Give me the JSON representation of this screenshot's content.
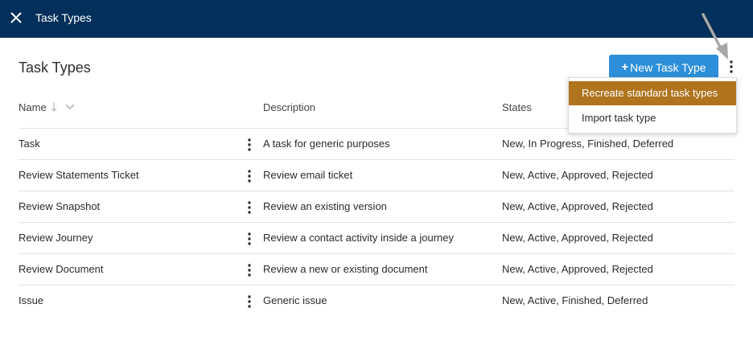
{
  "topbar": {
    "title": "Task Types"
  },
  "page": {
    "title": "Task Types"
  },
  "toolbar": {
    "new_label": "New Task Type",
    "new_plus": "+"
  },
  "columns": {
    "name": "Name",
    "description": "Description",
    "states": "States"
  },
  "rows": [
    {
      "name": "Task",
      "description": "A task for generic purposes",
      "states": "New, In Progress, Finished, Deferred"
    },
    {
      "name": "Review Statements Ticket",
      "description": "Review email ticket",
      "states": "New, Active, Approved, Rejected"
    },
    {
      "name": "Review Snapshot",
      "description": "Review an existing version",
      "states": "New, Active, Approved, Rejected"
    },
    {
      "name": "Review Journey",
      "description": "Review a contact activity inside a journey",
      "states": "New, Active, Approved, Rejected"
    },
    {
      "name": "Review Document",
      "description": "Review a new or existing document",
      "states": "New, Active, Approved, Rejected"
    },
    {
      "name": "Issue",
      "description": "Generic issue",
      "states": "New, Active, Finished, Deferred"
    }
  ],
  "menu": {
    "items": [
      {
        "label": "Recreate standard task types"
      },
      {
        "label": "Import task type"
      }
    ]
  },
  "colors": {
    "topbar": "#03305a",
    "primary_button": "#2d8fd9",
    "menu_highlight": "#b0741e"
  },
  "icons": {
    "close": "close-icon",
    "more": "more-vertical-icon",
    "sort": "sort-arrow-icon",
    "dropdown": "chevron-down-icon"
  }
}
